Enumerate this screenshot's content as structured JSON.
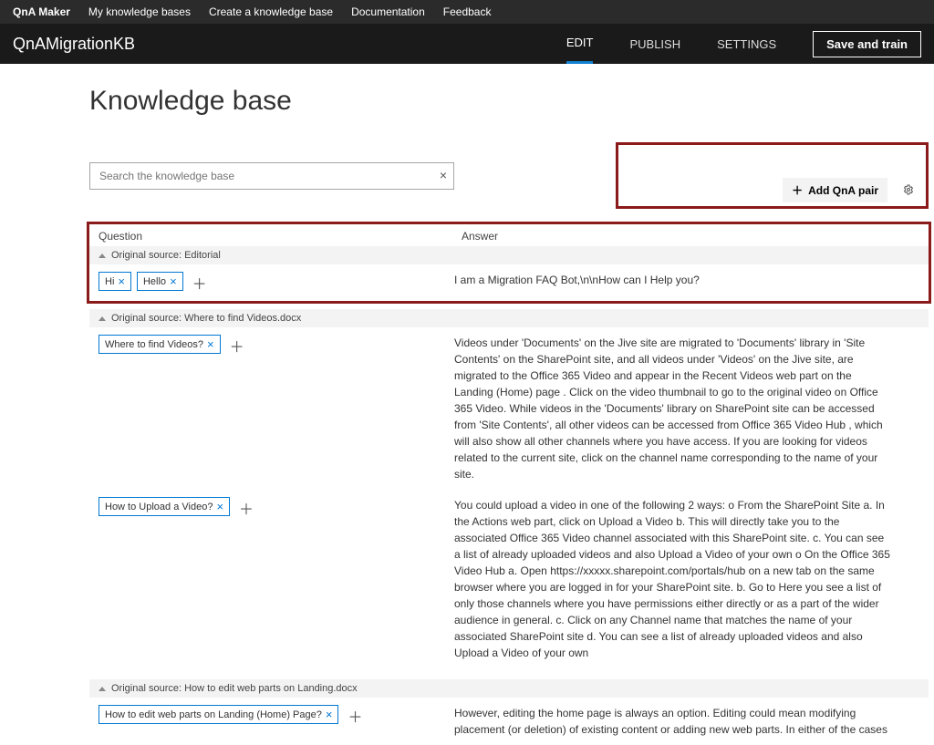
{
  "topnav": {
    "brand": "QnA Maker",
    "items": [
      "My knowledge bases",
      "Create a knowledge base",
      "Documentation",
      "Feedback"
    ]
  },
  "subnav": {
    "kbName": "QnAMigrationKB",
    "tabs": {
      "edit": "EDIT",
      "publish": "PUBLISH",
      "settings": "SETTINGS"
    },
    "save": "Save and train"
  },
  "page": {
    "title": "Knowledge base",
    "searchPlaceholder": "Search the knowledge base",
    "addPair": "Add QnA pair"
  },
  "cols": {
    "q": "Question",
    "a": "Answer"
  },
  "sourcePrefix": "Original source: ",
  "groups": [
    {
      "source": "Editorial",
      "pairs": [
        {
          "questions": [
            "Hi",
            "Hello"
          ],
          "answer": "I am a Migration FAQ Bot,\\n\\nHow can I Help you?"
        }
      ]
    },
    {
      "source": "Where to find Videos.docx",
      "pairs": [
        {
          "questions": [
            "Where to find Videos?"
          ],
          "answer": "Videos under 'Documents' on the Jive site are migrated to 'Documents' library in 'Site Contents' on the SharePoint site, and all videos under 'Videos' on the Jive site, are migrated to the Office 365 Video and appear in the Recent Videos web part on the Landing (Home) page . Click on the video thumbnail to go to the original video on Office 365 Video. While videos in the 'Documents' library on SharePoint site can be accessed from 'Site Contents', all other videos can be accessed from Office 365 Video Hub , which will also show all other channels where you have access. If you are looking for videos related to the current site, click on the channel name corresponding to the name of your site."
        },
        {
          "questions": [
            "How to Upload a Video?"
          ],
          "answer": "You could upload a video in one of the following 2 ways: o From the SharePoint Site a. In the Actions web part, click on Upload a Video b. This will directly take you to the associated Office 365 Video channel associated with this SharePoint site. c. You can see a list of already uploaded videos and also Upload a Video of your own o On the Office 365 Video Hub a. Open https://xxxxx.sharepoint.com/portals/hub on a new tab on the same browser where you are logged in for your SharePoint site. b. Go to Here you see a list of only those channels where you have permissions either directly or as a part of the wider audience in general. c. Click on any Channel name that matches the name of your associated SharePoint site d. You can see a list of already uploaded videos and also Upload a Video of your own"
        }
      ]
    },
    {
      "source": "How to edit web parts on Landing.docx",
      "pairs": [
        {
          "questions": [
            "How to edit web parts on Landing (Home) Page?"
          ],
          "answer": "However, editing the home page is always an option. Editing could mean modifying placement (or deletion) of existing content or adding new web parts. In either of the cases"
        }
      ]
    }
  ]
}
